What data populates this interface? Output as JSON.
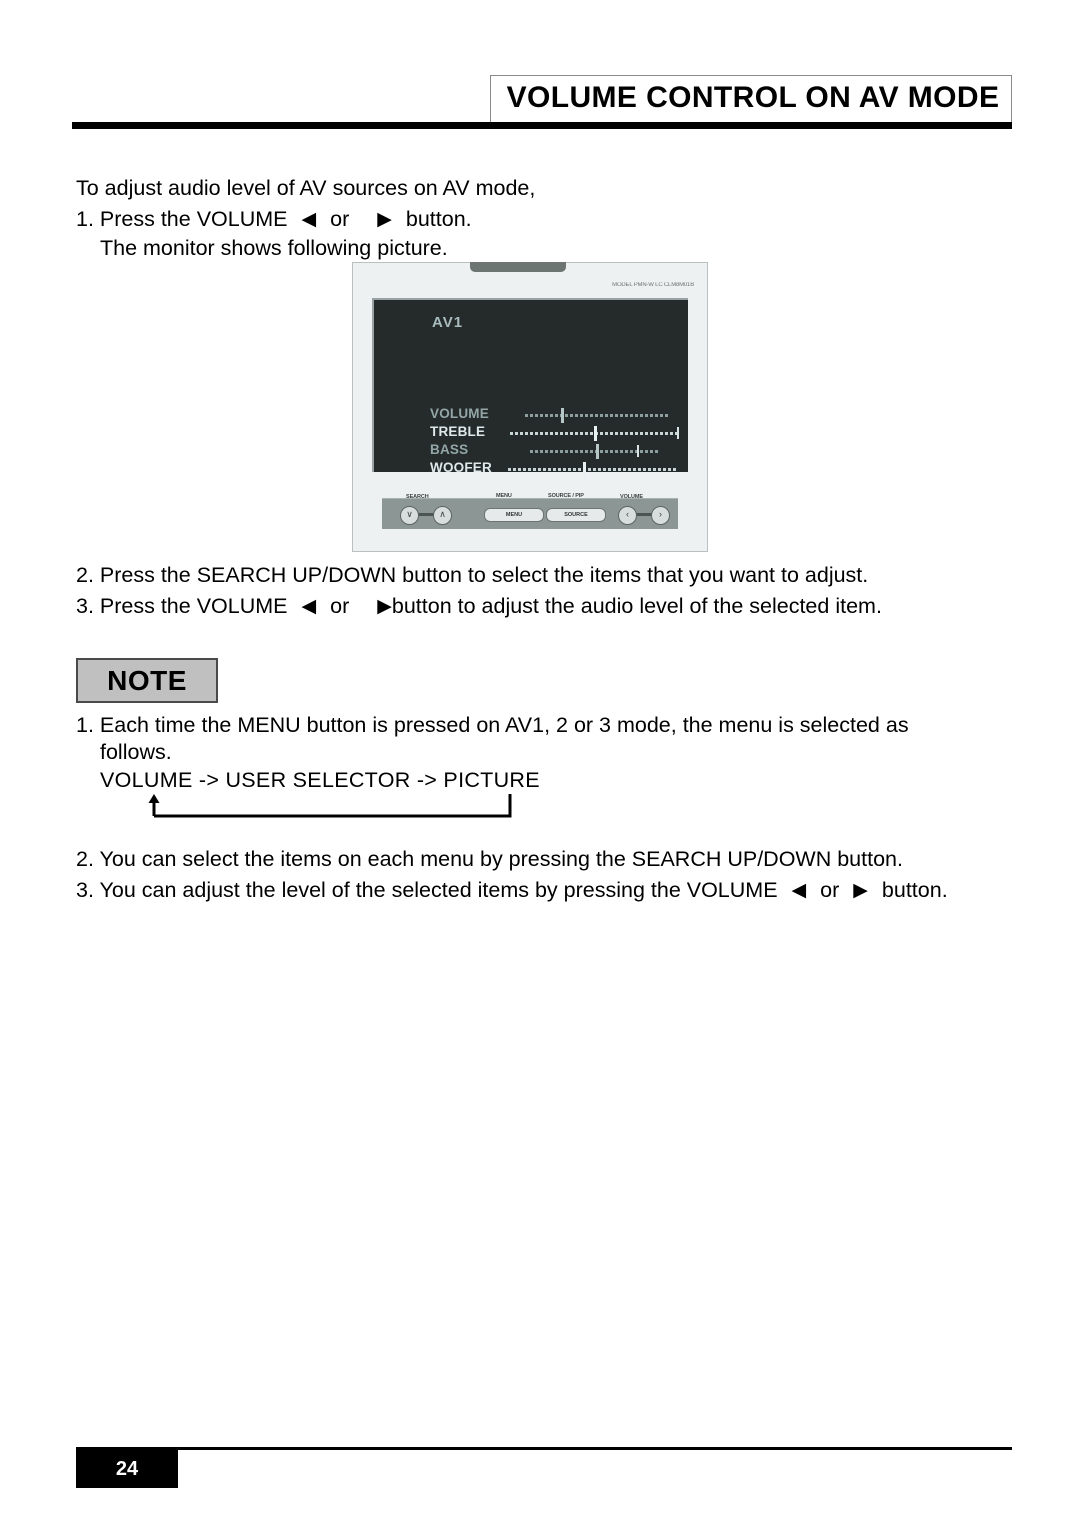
{
  "header": {
    "title": "VOLUME CONTROL ON AV MODE"
  },
  "body": {
    "intro": "To adjust audio level of AV sources on AV mode,",
    "step1_prefix": "1. Press the VOLUME",
    "step1_left_arrow": "◀",
    "step1_or": "or",
    "step1_right_arrow": "▶",
    "step1_suffix": "button.",
    "step1b": "The monitor shows following picture.",
    "step2": "2. Press the SEARCH UP/DOWN button to select the items that you want to adjust.",
    "step3_prefix": "3. Press the VOLUME",
    "step3_left_arrow": "◀",
    "step3_or": "or",
    "step3_right_arrow": "▶",
    "step3_suffix": "button to adjust the audio level of the selected item."
  },
  "note": {
    "label": "NOTE",
    "item1_line1": "1. Each time the MENU button is pressed on AV1, 2 or 3 mode, the menu is selected as",
    "item1_line2": "follows.",
    "item1_chain": "VOLUME -> USER SELECTOR -> PICTURE",
    "item2": "2. You can select the items on each menu by pressing the SEARCH UP/DOWN button.",
    "item3_prefix": "3. You can adjust the level of the selected items by pressing the VOLUME",
    "item3_left_arrow": "◀",
    "item3_or": "or",
    "item3_right_arrow": "▶",
    "item3_suffix": "button."
  },
  "tv": {
    "brand_strip": "MODEL PMN-W LC CLM8M01B",
    "osd": {
      "source": "AV1",
      "rows": [
        {
          "label": "VOLUME",
          "cursor_pct": 25,
          "track_start": 95,
          "track_width": 145,
          "dim": true,
          "endcap": false
        },
        {
          "label": "TREBLE",
          "cursor_pct": 50,
          "track_start": 80,
          "track_width": 168,
          "dim": false,
          "endcap": true
        },
        {
          "label": "BASS",
          "cursor_pct": 52,
          "track_start": 100,
          "track_width": 128,
          "dim": true,
          "endcap": true
        },
        {
          "label": "WOOFER",
          "cursor_pct": 45,
          "track_start": 78,
          "track_width": 168,
          "dim": false,
          "endcap": false
        }
      ]
    },
    "panel": {
      "label_search": "SEARCH",
      "label_menu": "MENU",
      "label_source": "SOURCE / PIP",
      "label_volume": "VOLUME",
      "btn_menu": "MENU",
      "btn_source": "SOURCE",
      "knob_down": "∨",
      "knob_up": "∧",
      "knob_left": "‹",
      "knob_right": "›"
    }
  },
  "footer": {
    "page_number": "24"
  }
}
